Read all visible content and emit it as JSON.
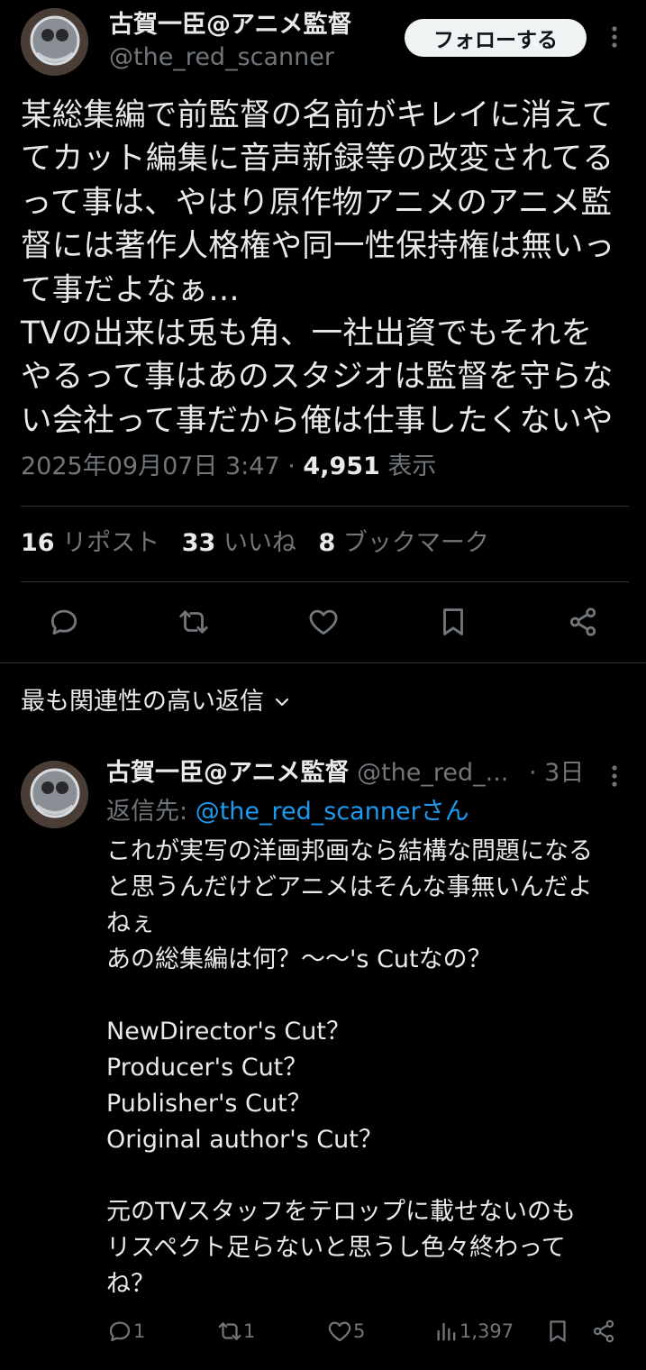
{
  "author": {
    "display_name": "古賀一臣@アニメ監督",
    "handle": "@the_red_scanner",
    "follow_label": "フォローする"
  },
  "tweet": {
    "text": "某総集編で前監督の名前がキレイに消えて\nてカット編集に音声新録等の改変されてる\nって事は、やはり原作物アニメのアニメ監\n督には著作人格権や同一性保持権は無いっ\nて事だよなぁ…\nTVの出来は兎も角、一社出資でもそれを\nやるって事はあのスタジオは監督を守らな\nい会社って事だから俺は仕事したくないや",
    "timestamp": "2025年09月07日 3:47",
    "separator": "·",
    "views_count": "4,951",
    "views_label": "表示"
  },
  "stats": {
    "reposts_count": "16",
    "reposts_label": "リポスト",
    "likes_count": "33",
    "likes_label": "いいね",
    "bookmarks_count": "8",
    "bookmarks_label": "ブックマーク"
  },
  "replies_header": {
    "label": "最も関連性の高い返信"
  },
  "reply": {
    "display_name": "古賀一臣@アニメ監督",
    "handle": "@the_red_...",
    "time": "· 3日",
    "reply_to_prefix": "返信先:",
    "reply_to_handle": "@the_red_scanner",
    "reply_to_suffix": "さん",
    "text": "これが実写の洋画邦画なら結構な問題になる\nと思うんだけどアニメはそんな事無いんだよ\nねぇ\nあの総集編は何？〜〜's Cutなの？\n\nNewDirector's Cut？\nProducer's Cut？\nPublisher's Cut？\nOriginal author's Cut？\n\n元のTVスタッフをテロップに載せないのも\nリスペクト足らないと思うし色々終わって\nね？",
    "reply_count": "1",
    "repost_count": "1",
    "like_count": "5",
    "view_count": "1,397"
  },
  "colors": {
    "background": "#000000",
    "text": "#e7e9ea",
    "muted": "#71767b",
    "link": "#1d9bf0",
    "divider": "#2f3336"
  },
  "icons": [
    "more-icon",
    "reply-icon",
    "repost-icon",
    "like-icon",
    "bookmark-icon",
    "share-icon",
    "chevron-down-icon",
    "views-icon"
  ]
}
